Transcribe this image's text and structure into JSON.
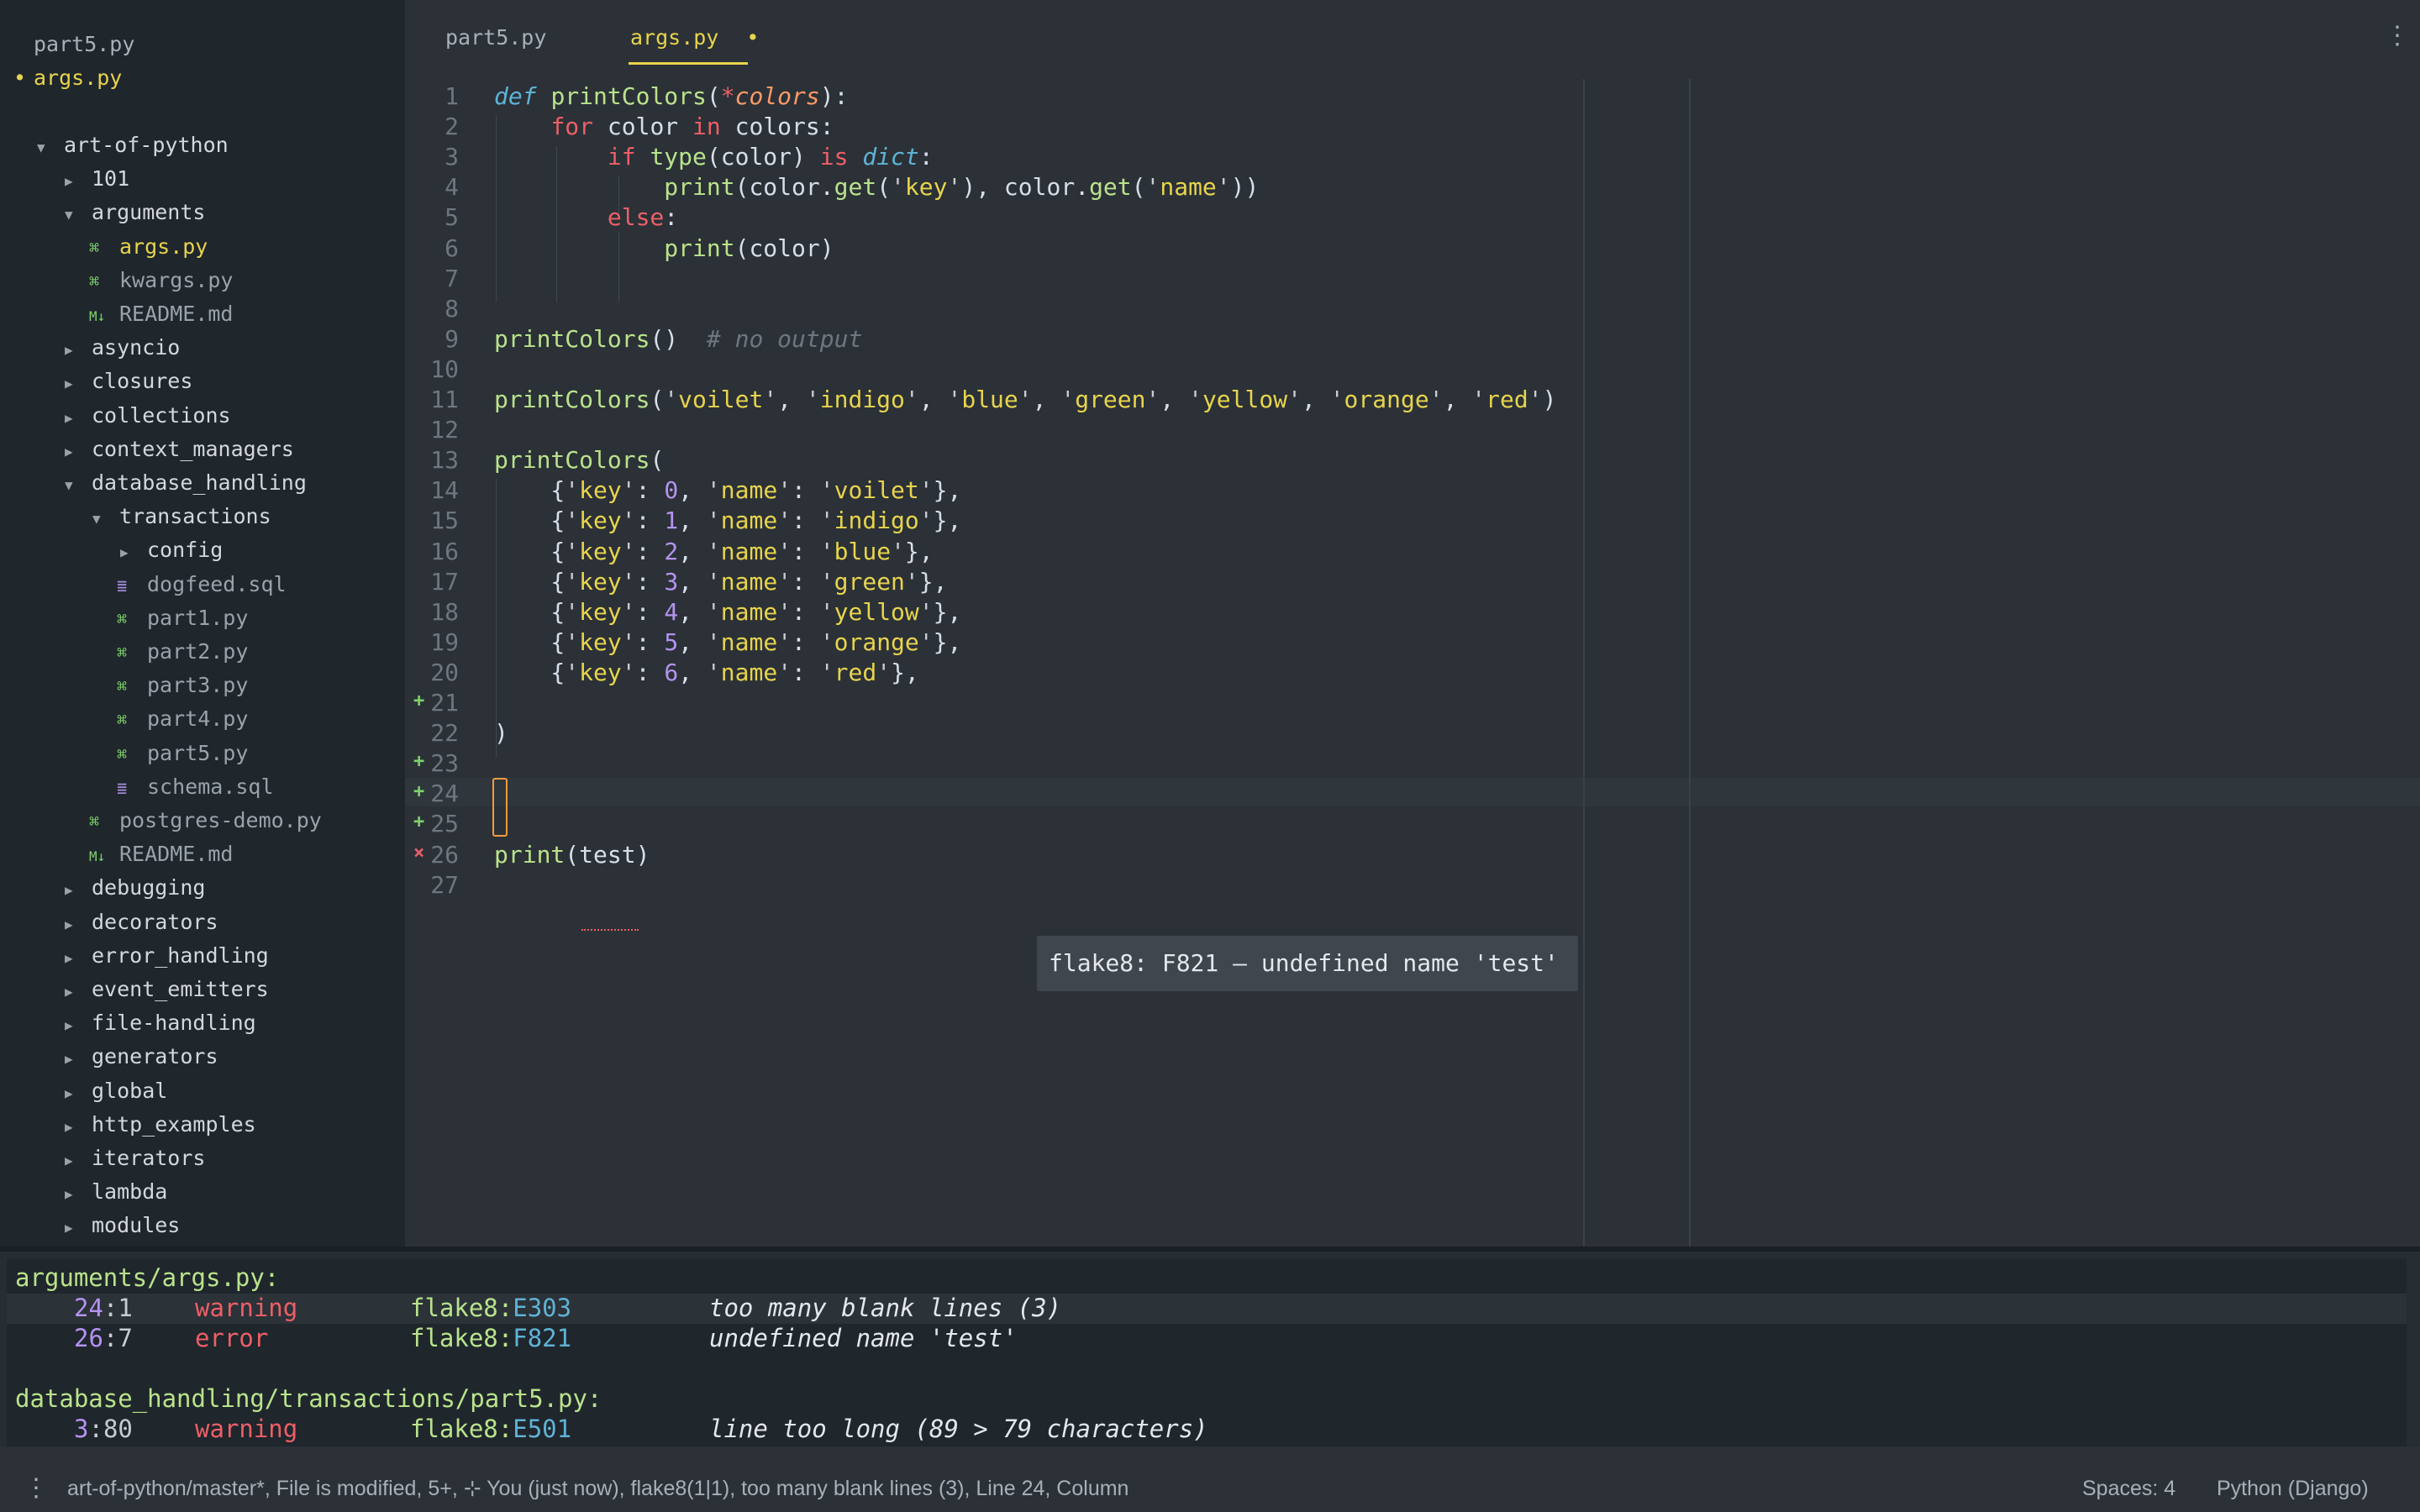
{
  "open_files": [
    {
      "name": "part5.py",
      "active": false
    },
    {
      "name": "args.py",
      "active": true,
      "modified_marker": "•"
    }
  ],
  "tree": [
    {
      "label": "art-of-python",
      "type": "folder",
      "open": true,
      "depth": 0
    },
    {
      "label": "101",
      "type": "folder",
      "open": false,
      "depth": 1
    },
    {
      "label": "arguments",
      "type": "folder",
      "open": true,
      "depth": 1
    },
    {
      "label": "args.py",
      "type": "py",
      "depth": 2,
      "active": true
    },
    {
      "label": "kwargs.py",
      "type": "py",
      "depth": 2
    },
    {
      "label": "README.md",
      "type": "md",
      "depth": 2
    },
    {
      "label": "asyncio",
      "type": "folder",
      "open": false,
      "depth": 1
    },
    {
      "label": "closures",
      "type": "folder",
      "open": false,
      "depth": 1
    },
    {
      "label": "collections",
      "type": "folder",
      "open": false,
      "depth": 1
    },
    {
      "label": "context_managers",
      "type": "folder",
      "open": false,
      "depth": 1
    },
    {
      "label": "database_handling",
      "type": "folder",
      "open": true,
      "depth": 1
    },
    {
      "label": "transactions",
      "type": "folder",
      "open": true,
      "depth": 2
    },
    {
      "label": "config",
      "type": "folder",
      "open": false,
      "depth": 3
    },
    {
      "label": "dogfeed.sql",
      "type": "sql",
      "depth": 3
    },
    {
      "label": "part1.py",
      "type": "py",
      "depth": 3
    },
    {
      "label": "part2.py",
      "type": "py",
      "depth": 3
    },
    {
      "label": "part3.py",
      "type": "py",
      "depth": 3
    },
    {
      "label": "part4.py",
      "type": "py",
      "depth": 3
    },
    {
      "label": "part5.py",
      "type": "py",
      "depth": 3
    },
    {
      "label": "schema.sql",
      "type": "sql",
      "depth": 3
    },
    {
      "label": "postgres-demo.py",
      "type": "py",
      "depth": 2
    },
    {
      "label": "README.md",
      "type": "md",
      "depth": 2
    },
    {
      "label": "debugging",
      "type": "folder",
      "open": false,
      "depth": 1
    },
    {
      "label": "decorators",
      "type": "folder",
      "open": false,
      "depth": 1
    },
    {
      "label": "error_handling",
      "type": "folder",
      "open": false,
      "depth": 1
    },
    {
      "label": "event_emitters",
      "type": "folder",
      "open": false,
      "depth": 1
    },
    {
      "label": "file-handling",
      "type": "folder",
      "open": false,
      "depth": 1
    },
    {
      "label": "generators",
      "type": "folder",
      "open": false,
      "depth": 1
    },
    {
      "label": "global",
      "type": "folder",
      "open": false,
      "depth": 1
    },
    {
      "label": "http_examples",
      "type": "folder",
      "open": false,
      "depth": 1
    },
    {
      "label": "iterators",
      "type": "folder",
      "open": false,
      "depth": 1
    },
    {
      "label": "lambda",
      "type": "folder",
      "open": false,
      "depth": 1
    },
    {
      "label": "modules",
      "type": "folder",
      "open": false,
      "depth": 1
    }
  ],
  "tabs": [
    {
      "label": "part5.py",
      "active": false
    },
    {
      "label": "args.py",
      "active": true,
      "modified_marker": "•"
    }
  ],
  "menu_icon": "⋮",
  "editor": {
    "line_numbers": [
      "1",
      "2",
      "3",
      "4",
      "5",
      "6",
      "7",
      "8",
      "9",
      "10",
      "11",
      "12",
      "13",
      "14",
      "15",
      "16",
      "17",
      "18",
      "19",
      "20",
      "21",
      "22",
      "23",
      "24",
      "25",
      "26",
      "27"
    ],
    "gutter_marks": [
      {
        "line": 21,
        "kind": "add",
        "glyph": "+"
      },
      {
        "line": 23,
        "kind": "add",
        "glyph": "+"
      },
      {
        "line": 24,
        "kind": "add",
        "glyph": "+"
      },
      {
        "line": 25,
        "kind": "add",
        "glyph": "+"
      },
      {
        "line": 26,
        "kind": "err",
        "glyph": "×"
      }
    ],
    "lines": [
      [
        [
          "df",
          "def"
        ],
        [
          "pl",
          " "
        ],
        [
          "fn",
          "printColors"
        ],
        [
          "pl",
          "("
        ],
        [
          "kw",
          "*"
        ],
        [
          "vr",
          "colors"
        ],
        [
          "pl",
          "):"
        ]
      ],
      [
        [
          "pl",
          "    "
        ],
        [
          "kw",
          "for"
        ],
        [
          "pl",
          " color "
        ],
        [
          "kw",
          "in"
        ],
        [
          "pl",
          " colors:"
        ]
      ],
      [
        [
          "pl",
          "        "
        ],
        [
          "kw",
          "if"
        ],
        [
          "pl",
          " "
        ],
        [
          "gr",
          "type"
        ],
        [
          "pl",
          "(color) "
        ],
        [
          "kw",
          "is"
        ],
        [
          "pl",
          " "
        ],
        [
          "bi",
          "dict"
        ],
        [
          "pl",
          ":"
        ]
      ],
      [
        [
          "pl",
          "            "
        ],
        [
          "gr",
          "print"
        ],
        [
          "pl",
          "(color."
        ],
        [
          "gr",
          "get"
        ],
        [
          "pl",
          "("
        ],
        [
          "qt",
          "'"
        ],
        [
          "st",
          "key"
        ],
        [
          "qt",
          "'"
        ],
        [
          "pl",
          "), color."
        ],
        [
          "gr",
          "get"
        ],
        [
          "pl",
          "("
        ],
        [
          "qt",
          "'"
        ],
        [
          "st",
          "name"
        ],
        [
          "qt",
          "'"
        ],
        [
          "pl",
          "))"
        ]
      ],
      [
        [
          "pl",
          "        "
        ],
        [
          "kw",
          "else"
        ],
        [
          "pl",
          ":"
        ]
      ],
      [
        [
          "pl",
          "            "
        ],
        [
          "gr",
          "print"
        ],
        [
          "pl",
          "(color)"
        ]
      ],
      [],
      [],
      [
        [
          "fn",
          "printColors"
        ],
        [
          "pl",
          "()  "
        ],
        [
          "cm",
          "# no output"
        ]
      ],
      [],
      [
        [
          "fn",
          "printColors"
        ],
        [
          "pl",
          "("
        ],
        [
          "qt",
          "'"
        ],
        [
          "st",
          "voilet"
        ],
        [
          "qt",
          "'"
        ],
        [
          "pl",
          ", "
        ],
        [
          "qt",
          "'"
        ],
        [
          "st",
          "indigo"
        ],
        [
          "qt",
          "'"
        ],
        [
          "pl",
          ", "
        ],
        [
          "qt",
          "'"
        ],
        [
          "st",
          "blue"
        ],
        [
          "qt",
          "'"
        ],
        [
          "pl",
          ", "
        ],
        [
          "qt",
          "'"
        ],
        [
          "st",
          "green"
        ],
        [
          "qt",
          "'"
        ],
        [
          "pl",
          ", "
        ],
        [
          "qt",
          "'"
        ],
        [
          "st",
          "yellow"
        ],
        [
          "qt",
          "'"
        ],
        [
          "pl",
          ", "
        ],
        [
          "qt",
          "'"
        ],
        [
          "st",
          "orange"
        ],
        [
          "qt",
          "'"
        ],
        [
          "pl",
          ", "
        ],
        [
          "qt",
          "'"
        ],
        [
          "st",
          "red"
        ],
        [
          "qt",
          "'"
        ],
        [
          "pl",
          ")"
        ]
      ],
      [],
      [
        [
          "fn",
          "printColors"
        ],
        [
          "pl",
          "("
        ]
      ],
      [
        [
          "pl",
          "    {"
        ],
        [
          "qt",
          "'"
        ],
        [
          "st",
          "key"
        ],
        [
          "qt",
          "'"
        ],
        [
          "pl",
          ": "
        ],
        [
          "nm",
          "0"
        ],
        [
          "pl",
          ", "
        ],
        [
          "qt",
          "'"
        ],
        [
          "st",
          "name"
        ],
        [
          "qt",
          "'"
        ],
        [
          "pl",
          ": "
        ],
        [
          "qt",
          "'"
        ],
        [
          "st",
          "voilet"
        ],
        [
          "qt",
          "'"
        ],
        [
          "pl",
          "},"
        ]
      ],
      [
        [
          "pl",
          "    {"
        ],
        [
          "qt",
          "'"
        ],
        [
          "st",
          "key"
        ],
        [
          "qt",
          "'"
        ],
        [
          "pl",
          ": "
        ],
        [
          "nm",
          "1"
        ],
        [
          "pl",
          ", "
        ],
        [
          "qt",
          "'"
        ],
        [
          "st",
          "name"
        ],
        [
          "qt",
          "'"
        ],
        [
          "pl",
          ": "
        ],
        [
          "qt",
          "'"
        ],
        [
          "st",
          "indigo"
        ],
        [
          "qt",
          "'"
        ],
        [
          "pl",
          "},"
        ]
      ],
      [
        [
          "pl",
          "    {"
        ],
        [
          "qt",
          "'"
        ],
        [
          "st",
          "key"
        ],
        [
          "qt",
          "'"
        ],
        [
          "pl",
          ": "
        ],
        [
          "nm",
          "2"
        ],
        [
          "pl",
          ", "
        ],
        [
          "qt",
          "'"
        ],
        [
          "st",
          "name"
        ],
        [
          "qt",
          "'"
        ],
        [
          "pl",
          ": "
        ],
        [
          "qt",
          "'"
        ],
        [
          "st",
          "blue"
        ],
        [
          "qt",
          "'"
        ],
        [
          "pl",
          "},"
        ]
      ],
      [
        [
          "pl",
          "    {"
        ],
        [
          "qt",
          "'"
        ],
        [
          "st",
          "key"
        ],
        [
          "qt",
          "'"
        ],
        [
          "pl",
          ": "
        ],
        [
          "nm",
          "3"
        ],
        [
          "pl",
          ", "
        ],
        [
          "qt",
          "'"
        ],
        [
          "st",
          "name"
        ],
        [
          "qt",
          "'"
        ],
        [
          "pl",
          ": "
        ],
        [
          "qt",
          "'"
        ],
        [
          "st",
          "green"
        ],
        [
          "qt",
          "'"
        ],
        [
          "pl",
          "},"
        ]
      ],
      [
        [
          "pl",
          "    {"
        ],
        [
          "qt",
          "'"
        ],
        [
          "st",
          "key"
        ],
        [
          "qt",
          "'"
        ],
        [
          "pl",
          ": "
        ],
        [
          "nm",
          "4"
        ],
        [
          "pl",
          ", "
        ],
        [
          "qt",
          "'"
        ],
        [
          "st",
          "name"
        ],
        [
          "qt",
          "'"
        ],
        [
          "pl",
          ": "
        ],
        [
          "qt",
          "'"
        ],
        [
          "st",
          "yellow"
        ],
        [
          "qt",
          "'"
        ],
        [
          "pl",
          "},"
        ]
      ],
      [
        [
          "pl",
          "    {"
        ],
        [
          "qt",
          "'"
        ],
        [
          "st",
          "key"
        ],
        [
          "qt",
          "'"
        ],
        [
          "pl",
          ": "
        ],
        [
          "nm",
          "5"
        ],
        [
          "pl",
          ", "
        ],
        [
          "qt",
          "'"
        ],
        [
          "st",
          "name"
        ],
        [
          "qt",
          "'"
        ],
        [
          "pl",
          ": "
        ],
        [
          "qt",
          "'"
        ],
        [
          "st",
          "orange"
        ],
        [
          "qt",
          "'"
        ],
        [
          "pl",
          "},"
        ]
      ],
      [
        [
          "pl",
          "    {"
        ],
        [
          "qt",
          "'"
        ],
        [
          "st",
          "key"
        ],
        [
          "qt",
          "'"
        ],
        [
          "pl",
          ": "
        ],
        [
          "nm",
          "6"
        ],
        [
          "pl",
          ", "
        ],
        [
          "qt",
          "'"
        ],
        [
          "st",
          "name"
        ],
        [
          "qt",
          "'"
        ],
        [
          "pl",
          ": "
        ],
        [
          "qt",
          "'"
        ],
        [
          "st",
          "red"
        ],
        [
          "qt",
          "'"
        ],
        [
          "pl",
          "},"
        ]
      ],
      [],
      [
        [
          "pl",
          ")"
        ]
      ],
      [],
      [],
      [],
      [
        [
          "gr",
          "print"
        ],
        [
          "pl",
          "(test)"
        ]
      ],
      []
    ],
    "tooltip": "flake8: F821 – undefined name 'test'"
  },
  "lint": {
    "groups": [
      {
        "file": "arguments/args.py:",
        "rows": [
          {
            "line": "24",
            "col": "1",
            "severity": "warning",
            "linter": "flake8",
            "code": "E303",
            "message": "too many blank lines (3)",
            "highlight": true
          },
          {
            "line": "26",
            "col": "7",
            "severity": "error",
            "linter": "flake8",
            "code": "F821",
            "message": "undefined name 'test'",
            "highlight": false
          }
        ]
      },
      {
        "file": "database_handling/transactions/part5.py:",
        "rows": [
          {
            "line": "3",
            "col": "80",
            "severity": "warning",
            "linter": "flake8",
            "code": "E501",
            "message": "line too long (89 > 79 characters)",
            "highlight": false
          }
        ]
      }
    ]
  },
  "status": {
    "menu_icon": "⋮",
    "left": "art-of-python/master*, File is modified, 5+,  ⊹ You (just now), flake8(1|1), too many blank lines (3), Line 24, Column",
    "spaces": "Spaces: 4",
    "language": "Python (Django)"
  },
  "colors": {
    "accent": "#e8d44d",
    "sidebar_bg": "#1f262c",
    "editor_bg": "#2b3137",
    "error": "#ec5f67",
    "added": "#7ed36a"
  }
}
